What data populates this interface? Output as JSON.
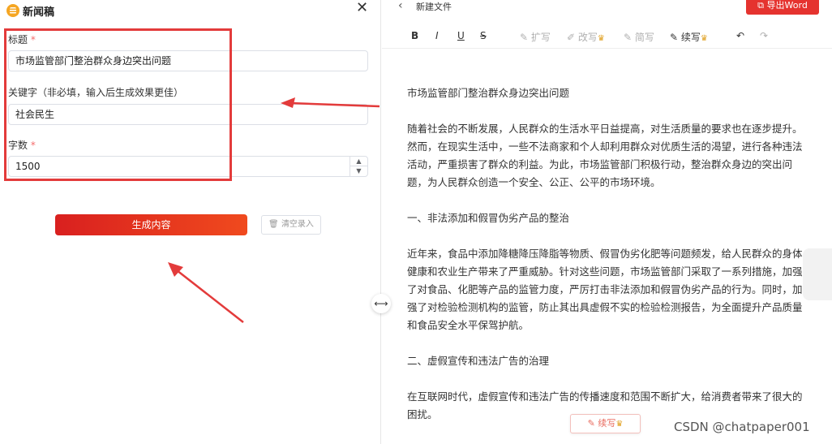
{
  "left": {
    "title": "新闻稿",
    "fields": [
      {
        "label": "标题",
        "required_mark": "*",
        "value": "市场监管部门整治群众身边突出问题"
      },
      {
        "label": "关键字（非必填，输入后生成效果更佳）",
        "value": "社会民生"
      },
      {
        "label": "字数",
        "required_mark": "*",
        "value": "1500"
      }
    ],
    "generate_label": "生成内容",
    "clear_label": "清空录入"
  },
  "right": {
    "doc_name": "新建文件",
    "export_label": "导出Word",
    "toolbar": {
      "bold": "B",
      "italic": "I",
      "underline": "U",
      "strike": "S",
      "expand": "扩写",
      "rewrite": "改写",
      "shorten": "简写",
      "continue": "续写",
      "undo": "↶",
      "redo": "↷"
    },
    "document": [
      "市场监管部门整治群众身边突出问题",
      "随着社会的不断发展，人民群众的生活水平日益提高，对生活质量的要求也在逐步提升。然而，在现实生活中，一些不法商家和个人却利用群众对优质生活的渴望，进行各种违法活动，严重损害了群众的利益。为此，市场监管部门积极行动，整治群众身边的突出问题，为人民群众创造一个安全、公正、公平的市场环境。",
      "一、非法添加和假冒伪劣产品的整治",
      "近年来，食品中添加降糖降压降脂等物质、假冒伪劣化肥等问题频发，给人民群众的身体健康和农业生产带来了严重威胁。针对这些问题，市场监管部门采取了一系列措施，加强了对食品、化肥等产品的监管力度，严厉打击非法添加和假冒伪劣产品的行为。同时，加强了对检验检测机构的监管，防止其出具虚假不实的检验检测报告，为全面提升产品质量和食品安全水平保驾护航。",
      "二、虚假宣传和违法广告的治理",
      "在互联网时代，虚假宣传和违法广告的传播速度和范围不断扩大，给消费者带来了很大的困扰。"
    ],
    "float_label": "续写"
  },
  "watermark": "CSDN @chatpaper001",
  "colors": {
    "accent": "#e5332f",
    "annotation": "#e33b3b"
  }
}
